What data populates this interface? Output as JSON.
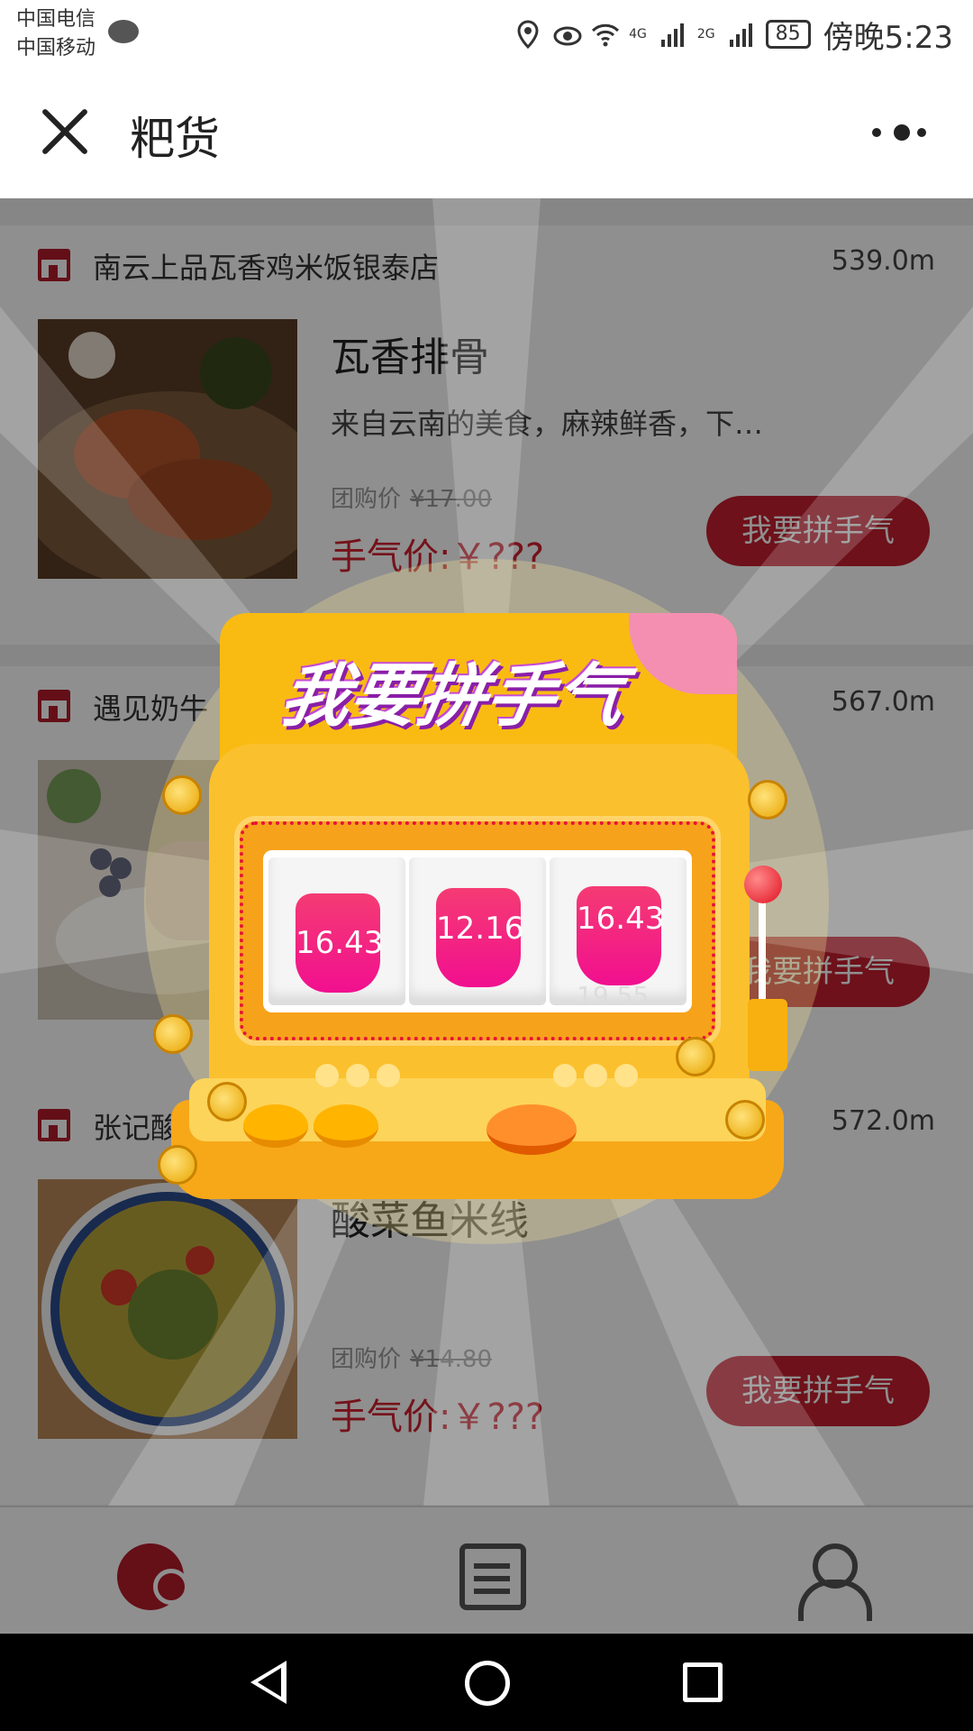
{
  "status_bar": {
    "carrier_1": "中国电信",
    "carrier_2": "中国移动",
    "network_1": "4G",
    "network_2": "2G",
    "battery": "85",
    "time": "傍晚5:23"
  },
  "nav": {
    "title": "粑货"
  },
  "cards": [
    {
      "store_name": "南云上品瓦香鸡米饭银泰店",
      "distance": "539.0m",
      "dish_name": "瓦香排骨",
      "description": "来自云南的美食，麻辣鲜香，下…",
      "group_label": "团购价",
      "group_price": "¥17.00",
      "luck_price": "手气价:￥???",
      "button": "我要拼手气"
    },
    {
      "store_name": "遇见奶牛",
      "distance": "567.0m",
      "button": "我要拼手气"
    },
    {
      "store_name": "张记酸菜",
      "distance": "572.0m",
      "dish_name": "酸菜鱼米线",
      "group_label": "团购价",
      "group_price": "¥14.80",
      "luck_price": "手气价:￥???",
      "button": "我要拼手气"
    }
  ],
  "popup": {
    "title": "我要拼手气",
    "reels": [
      "16.43",
      "12.16",
      "16.43"
    ],
    "reel_peek": [
      "19.55"
    ]
  },
  "tabbar": {
    "home_icon": "home-planet-icon",
    "orders_icon": "orders-list-icon",
    "profile_icon": "user-profile-icon"
  },
  "colors": {
    "brand_red": "#c51f2f",
    "price_red": "#d0212f",
    "machine_yellow": "#fbc02d",
    "reel_pink": "#f10f8f"
  }
}
